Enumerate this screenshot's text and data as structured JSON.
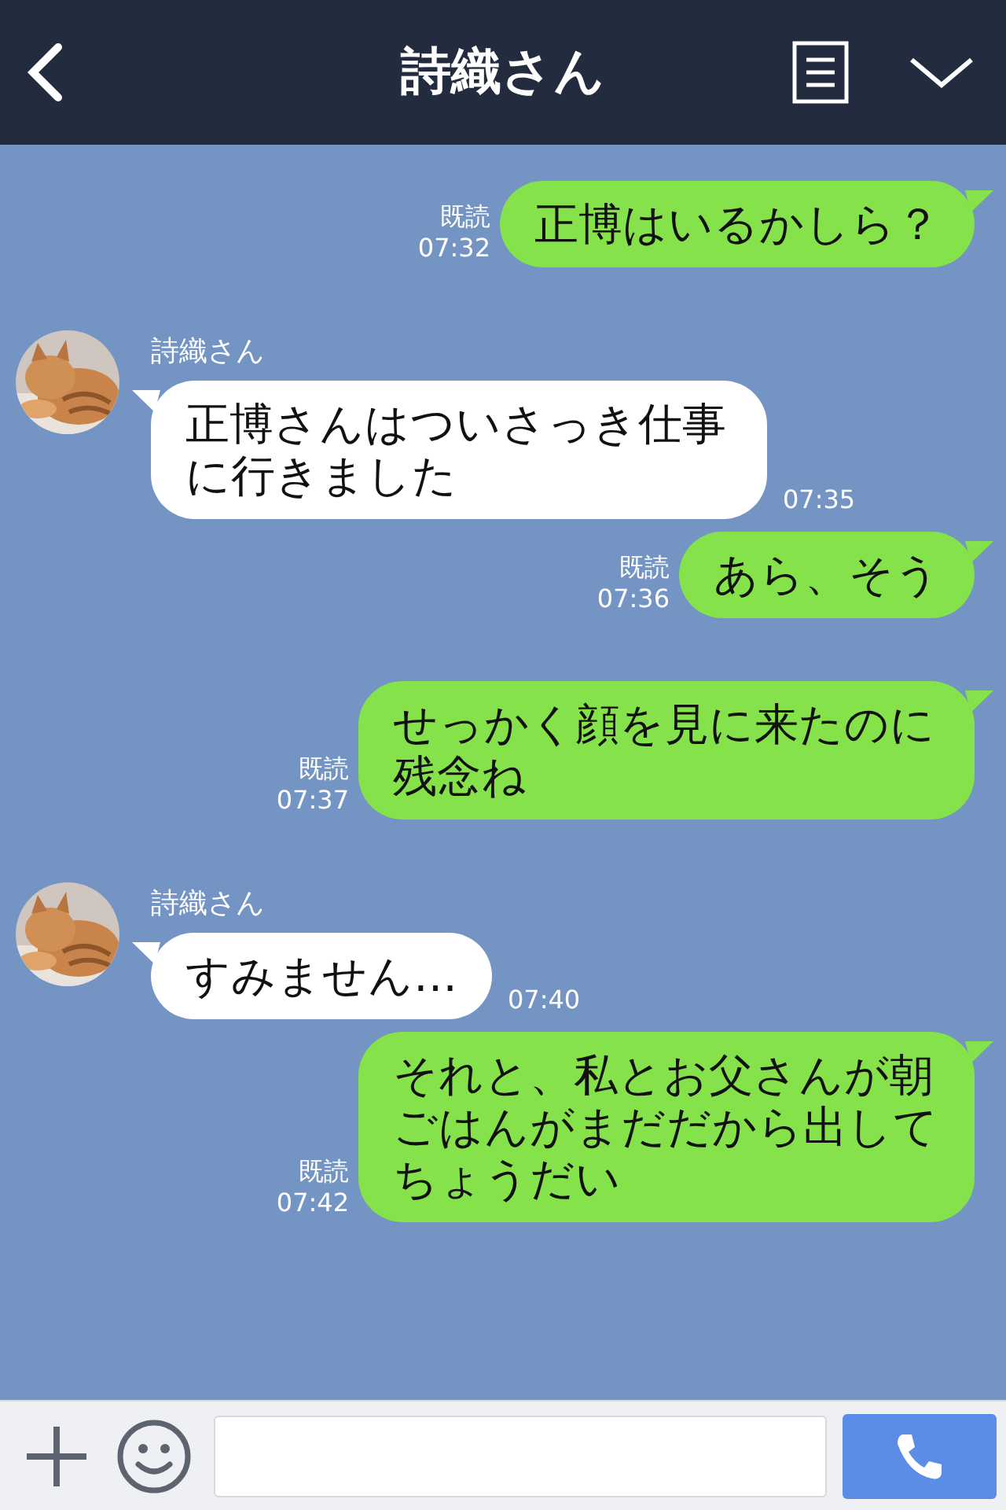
{
  "header": {
    "title": "詩織さん"
  },
  "messages": [
    {
      "kind": "sent",
      "text": "正博はいるかしら？",
      "read": "既読",
      "time": "07:32"
    },
    {
      "kind": "received",
      "sender": "詩織さん",
      "text": "正博さんはついさっき仕事に行きました",
      "time": "07:35"
    },
    {
      "kind": "sent",
      "text": "あら、そう",
      "read": "既読",
      "time": "07:36"
    },
    {
      "kind": "sent",
      "text": "せっかく顔を見に来たのに残念ね",
      "read": "既読",
      "time": "07:37"
    },
    {
      "kind": "received",
      "sender": "詩織さん",
      "text": "すみません…",
      "time": "07:40"
    },
    {
      "kind": "sent",
      "text": "それと、私とお父さんが朝ごはんがまだだから出してちょうだい",
      "read": "既読",
      "time": "07:42"
    }
  ]
}
